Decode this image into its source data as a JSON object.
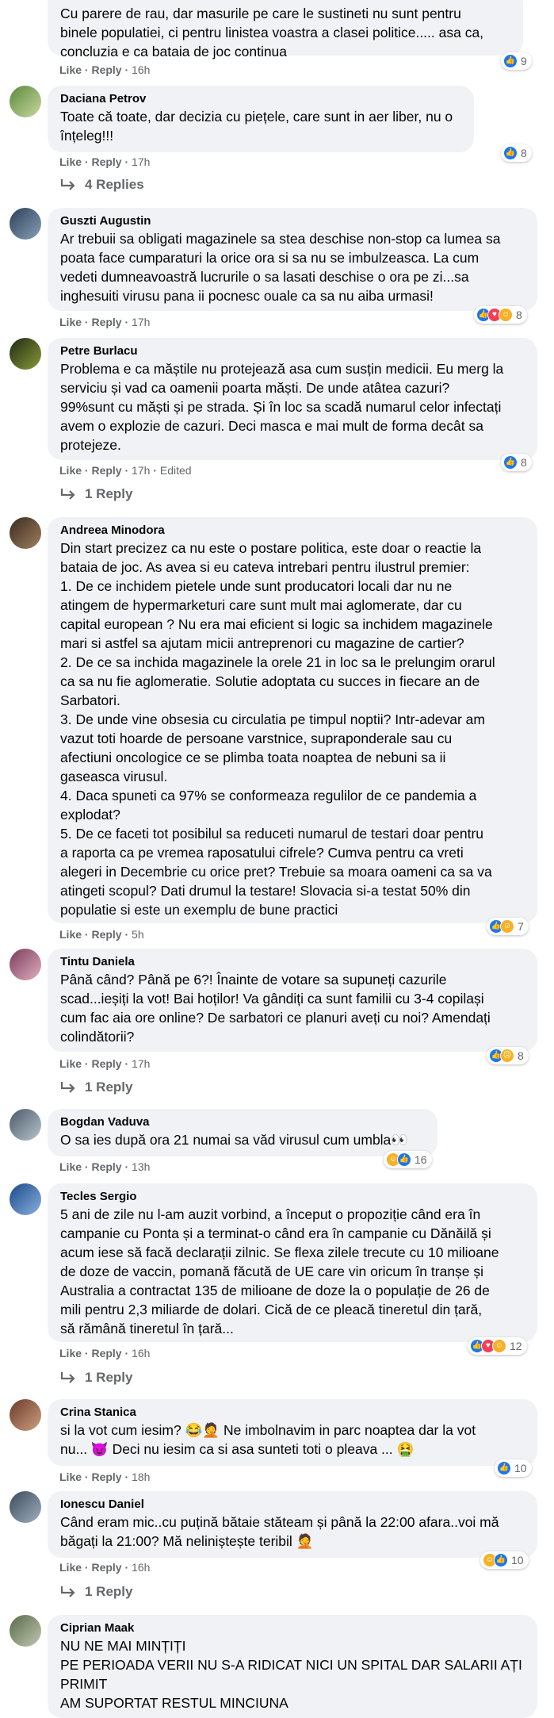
{
  "comments": [
    {
      "author": "",
      "text": "Cu parere de rau, dar masurile pe care le sustineti nu sunt pentru\nbinele populatiei, ci pentru linistea voastra a clasei politice..... asa ca,\nconcluzia e ca bataia de joc continua",
      "like": "Like",
      "reply": "Reply",
      "time": "16h",
      "edited": "",
      "reaction_count": "9",
      "reactions": [
        "like"
      ],
      "replies": ""
    },
    {
      "author": "Daciana Petrov",
      "text": "Toate că toate, dar decizia cu piețele, care sunt in aer liber, nu o\nînțeleg!!!",
      "like": "Like",
      "reply": "Reply",
      "time": "17h",
      "edited": "",
      "reaction_count": "8",
      "reactions": [
        "like"
      ],
      "replies": "4 Replies"
    },
    {
      "author": "Guszti Augustin",
      "text": "Ar trebuii sa obligati magazinele sa stea deschise non-stop ca lumea sa\npoata face cumparaturi la orice ora si sa nu se imbulzeasca. La cum\nvedeti dumneavoastră lucrurile o sa lasati deschise o ora pe zi...sa\ninghesuiti virusu pana ii pocnesc ouale ca sa nu aiba urmasi!",
      "like": "Like",
      "reply": "Reply",
      "time": "17h",
      "edited": "",
      "reaction_count": "8",
      "reactions": [
        "like",
        "love",
        "haha"
      ],
      "replies": ""
    },
    {
      "author": "Petre Burlacu",
      "text": "Problema e ca măștile nu protejează asa cum susțin medicii. Eu merg la\nserviciu și vad ca oamenii poarta măști. De unde atâtea cazuri?\n99%sunt cu măști și pe strada. Și în loc sa scadă numarul celor infectați\navem o explozie de cazuri. Deci masca e mai mult de forma decât sa\nprotejeze.",
      "like": "Like",
      "reply": "Reply",
      "time": "17h",
      "edited": "Edited",
      "reaction_count": "8",
      "reactions": [
        "like"
      ],
      "replies": "1 Reply"
    },
    {
      "author": "Andreea Minodora",
      "text": "Din start precizez ca nu este o postare politica, este doar o reactie la\nbataia de joc. As avea si eu cateva intrebari pentru ilustrul premier:\n1. De ce inchidem pietele unde sunt producatori locali dar nu ne\natingem de hypermarketuri care sunt mult mai aglomerate, dar cu\ncapital european ? Nu era mai eficient si logic sa inchidem magazinele\nmari si astfel sa ajutam micii antreprenori cu magazine de cartier?\n2. De ce sa inchida magazinele la orele 21 in loc sa le prelungim orarul\nca sa nu fie aglomeratie. Solutie adoptata cu succes in fiecare an de\nSarbatori.\n3. De unde vine obsesia cu circulatia pe timpul noptii? Intr-adevar am\nvazut toti hoarde de persoane varstnice, supraponderale sau cu\nafectiuni oncologice ce se plimba toata noaptea de nebuni sa ii\ngaseasca virusul.\n4. Daca spuneti ca 97% se conformeaza regulilor de ce pandemia a\nexplodat?\n5. De ce faceti tot posibilul sa reduceti numarul de testari doar pentru\na raporta ca pe vremea raposatului cifrele? Cumva pentru ca vreti\nalegeri in Decembrie cu orice pret? Trebuie sa moara oameni ca sa va\natingeti scopul? Dati drumul la testare! Slovacia si-a testat 50% din\npopulatie si este un exemplu de bune practici",
      "like": "Like",
      "reply": "Reply",
      "time": "5h",
      "edited": "",
      "reaction_count": "7",
      "reactions": [
        "like",
        "haha"
      ],
      "replies": ""
    },
    {
      "author": "Tintu Daniela",
      "text": "Până când? Până pe 6?! Înainte de votare sa supuneți cazurile\nscad...ieșiți la vot! Bai hoților! Va gândiți ca sunt familii cu 3-4 copilași\ncum fac aia ore online? De sarbatori ce planuri aveți cu noi? Amendați\ncolindătorii?",
      "like": "Like",
      "reply": "Reply",
      "time": "17h",
      "edited": "",
      "reaction_count": "8",
      "reactions": [
        "like",
        "sad"
      ],
      "replies": "1 Reply"
    },
    {
      "author": "Bogdan Vaduva",
      "text": "O sa ies după ora 21 numai sa văd virusul cum umbla👀",
      "like": "Like",
      "reply": "Reply",
      "time": "13h",
      "edited": "",
      "reaction_count": "16",
      "reactions": [
        "haha",
        "like"
      ],
      "replies": ""
    },
    {
      "author": "Tecles Sergio",
      "text": "5 ani de zile nu l-am auzit vorbind, a început o propoziție când era în\ncampanie cu Ponta și a terminat-o când era în campanie cu Dănăilă și\nacum iese să facă declarații zilnic. Se flexa zilele trecute cu 10 milioane\nde doze de vaccin, pomană făcută de UE care vin oricum în tranșe și\nAustralia a contractat 135 de milioane de doze la o populație de 26 de\nmili pentru 2,3 miliarde de dolari. Cică de ce pleacă tineretul din țară,\nsă rămână tineretul în țară...",
      "like": "Like",
      "reply": "Reply",
      "time": "16h",
      "edited": "",
      "reaction_count": "12",
      "reactions": [
        "like",
        "love",
        "haha"
      ],
      "replies": "1 Reply"
    },
    {
      "author": "Crina Stanica",
      "text": "si la vot cum iesim? 😂🤦 Ne imbolnavim in parc noaptea dar la vot\nnu... 😈 Deci nu iesim ca si asa sunteti toti o pleava ... 🤮",
      "like": "Like",
      "reply": "Reply",
      "time": "18h",
      "edited": "",
      "reaction_count": "10",
      "reactions": [
        "like"
      ],
      "replies": ""
    },
    {
      "author": "Ionescu Daniel",
      "text": "Când eram mic..cu puțină bătaie stăteam și până la 22:00 afara..voi mă\nbăgați la 21:00? Mă neliniștește teribil 🤦",
      "like": "Like",
      "reply": "Reply",
      "time": "16h",
      "edited": "",
      "reaction_count": "10",
      "reactions": [
        "haha",
        "like"
      ],
      "replies": "1 Reply"
    },
    {
      "author": "Ciprian Maak",
      "text": "NU NE MAI MINȚIȚI\nPE PERIOADA VERII NU S-A RIDICAT NICI UN SPITAL DAR SALARII AȚI\nPRIMIT\nAM SUPORTAT RESTUL MINCIUNA",
      "like": "",
      "reply": "",
      "time": "",
      "edited": "",
      "reaction_count": "",
      "reactions": [],
      "replies": ""
    }
  ],
  "colors": {
    "bubble": "#f0f2f5",
    "meta": "#65676b",
    "like": "#1877f2",
    "love": "#f33e58",
    "haha": "#f7b125"
  }
}
